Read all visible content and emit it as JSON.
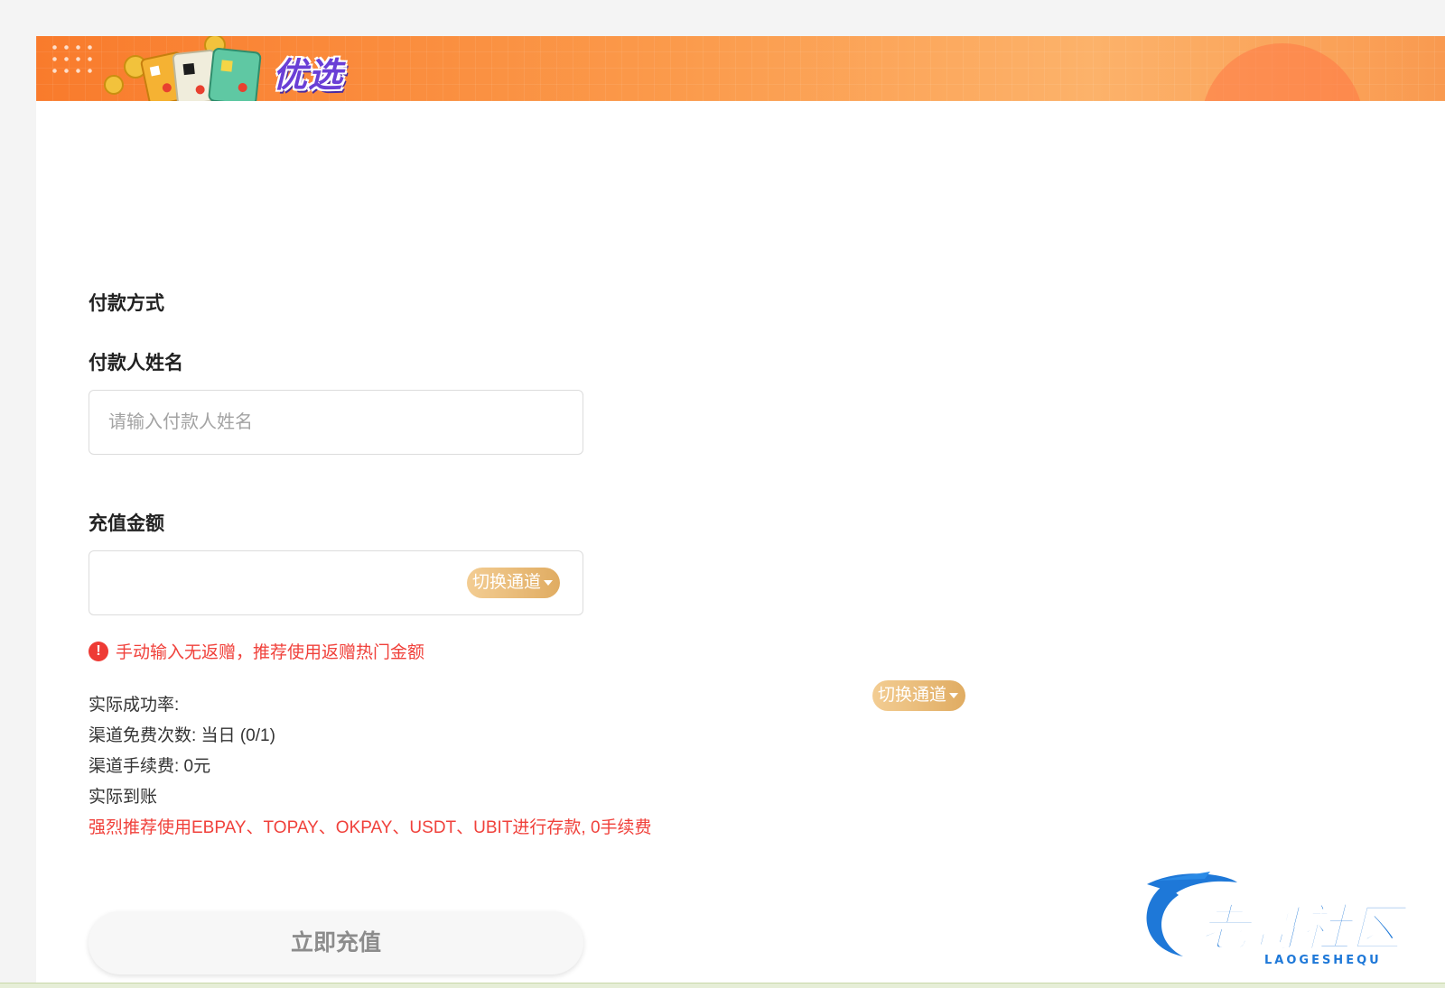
{
  "banner": {
    "title": "优选"
  },
  "form": {
    "payment_method_label": "付款方式",
    "payer_name_label": "付款人姓名",
    "payer_name_placeholder": "请输入付款人姓名",
    "payer_name_value": "",
    "amount_label": "充值金额",
    "amount_value": "",
    "switch_channel_label": "切换通道",
    "warning_text": "手动输入无返赠，推荐使用返赠热门金额"
  },
  "info": {
    "success_rate": "实际成功率:",
    "switch_channel_label": "切换通道",
    "free_times": "渠道免费次数: 当日 (0/1)",
    "fee": "渠道手续费: 0元",
    "actual_credit": "实际到账",
    "recommendation": "强烈推荐使用EBPAY、TOPAY、OKPAY、USDT、UBIT进行存款, 0手续费"
  },
  "submit_label": "立即充值",
  "watermark": {
    "text": "老哥社区",
    "subtext": "LAOGESHEQU"
  },
  "colors": {
    "banner_orange": "#f97b2c",
    "accent_gold": "#e0ac62",
    "warning_red": "#f0413b",
    "logo_blue": "#1e78d8"
  },
  "icons": [
    "dots-decoration",
    "coin-icon",
    "card-icon",
    "warning-icon",
    "caret-down-icon",
    "dragon-logo"
  ]
}
